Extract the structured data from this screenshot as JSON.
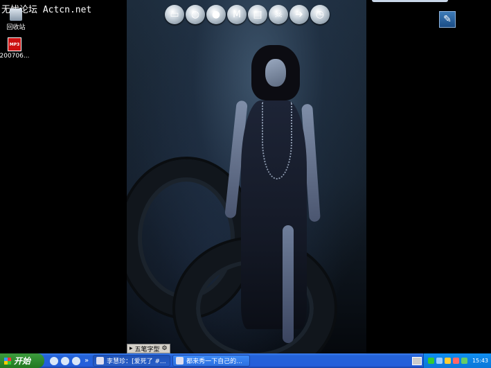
{
  "desktop": {
    "watermark": "无忧论坛 Actcn.net",
    "icons": [
      {
        "label": "回收站",
        "icon": "recycle-bin-icon"
      },
      {
        "label": "200706...",
        "icon": "mp3-file-icon",
        "badge": "MP3"
      }
    ],
    "top_shortcuts": [
      "monitor-icon",
      "globe-icon",
      "qq-penguin-icon",
      "maxthon-icon",
      "movie-clapper-icon",
      "skull-icon",
      "green-arrow-icon",
      "clock-icon"
    ],
    "corner_tool_icon": "pen-tool-icon"
  },
  "ime_bar": {
    "label": "五笔字型"
  },
  "taskbar": {
    "start_label": "开始",
    "chevron": "»",
    "tasks": [
      {
        "label": "李慧珍：[爱死了 #...",
        "active": true
      },
      {
        "label": "都来秀一下自己的...",
        "active": false
      }
    ],
    "clock": "15:43"
  },
  "colors": {
    "taskbar": "#245edb",
    "start": "#2f8a2f",
    "tray": "#0b76d8"
  }
}
